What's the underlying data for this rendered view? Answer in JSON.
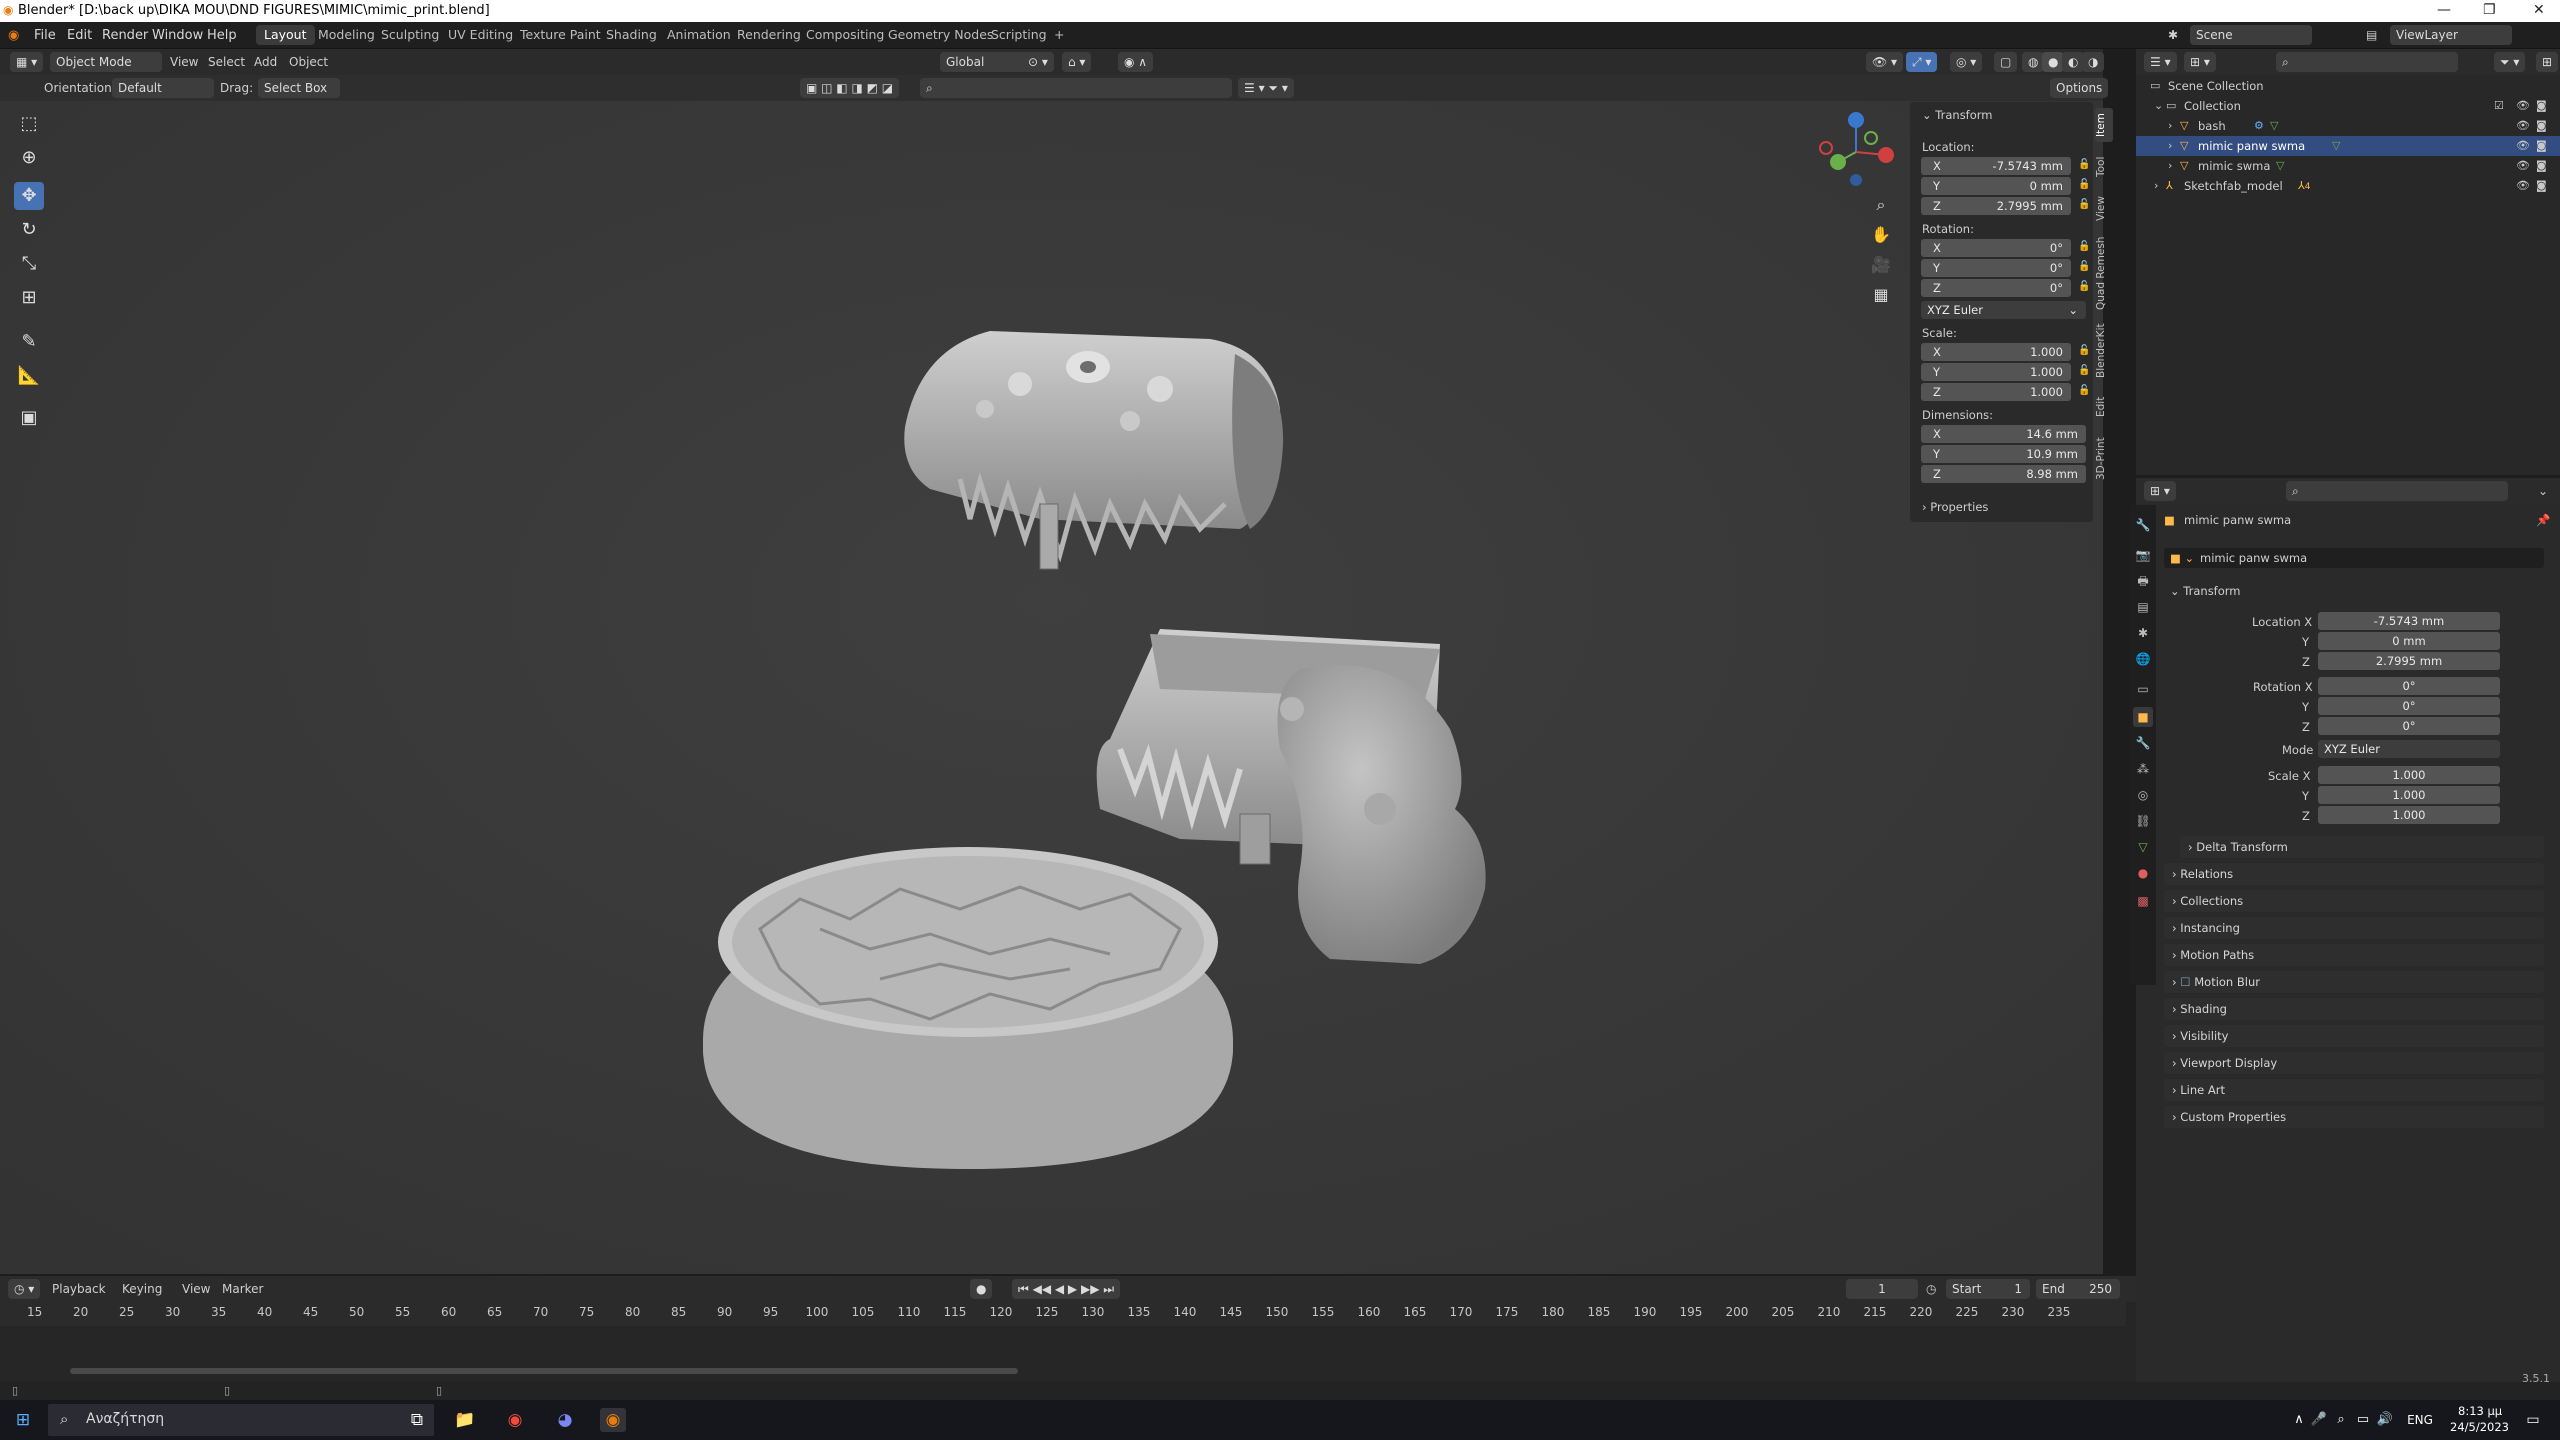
{
  "titlebar": {
    "title": "Blender* [D:\\back up\\DIKA MOU\\DND FIGURES\\MIMIC\\mimic_print.blend]",
    "min": "—",
    "max": "❐",
    "close": "✕"
  },
  "menu": {
    "file": "File",
    "edit": "Edit",
    "render": "Render",
    "window": "Window",
    "help": "Help"
  },
  "workspaces": [
    "Layout",
    "Modeling",
    "Sculpting",
    "UV Editing",
    "Texture Paint",
    "Shading",
    "Animation",
    "Rendering",
    "Compositing",
    "Geometry Nodes",
    "Scripting"
  ],
  "workspace_add": "+",
  "scene": {
    "label": "Scene",
    "viewlayer": "ViewLayer"
  },
  "viewport": {
    "mode": "Object Mode",
    "menus": [
      "View",
      "Select",
      "Add",
      "Object"
    ],
    "transform_orientation": "Global",
    "orientation_label": "Orientation:",
    "orientation_value": "Default",
    "drag_label": "Drag:",
    "drag_value": "Select Box",
    "options": "Options"
  },
  "npanel": {
    "section": "Transform",
    "location_label": "Location:",
    "location": [
      {
        "axis": "X",
        "value": "-7.5743 mm"
      },
      {
        "axis": "Y",
        "value": "0 mm"
      },
      {
        "axis": "Z",
        "value": "2.7995 mm"
      }
    ],
    "rotation_label": "Rotation:",
    "rotation": [
      {
        "axis": "X",
        "value": "0°"
      },
      {
        "axis": "Y",
        "value": "0°"
      },
      {
        "axis": "Z",
        "value": "0°"
      }
    ],
    "rotation_mode": "XYZ Euler",
    "scale_label": "Scale:",
    "scale": [
      {
        "axis": "X",
        "value": "1.000"
      },
      {
        "axis": "Y",
        "value": "1.000"
      },
      {
        "axis": "Z",
        "value": "1.000"
      }
    ],
    "dimensions_label": "Dimensions:",
    "dimensions": [
      {
        "axis": "X",
        "value": "14.6 mm"
      },
      {
        "axis": "Y",
        "value": "10.9 mm"
      },
      {
        "axis": "Z",
        "value": "8.98 mm"
      }
    ],
    "properties": "Properties",
    "tabs": [
      "Item",
      "Tool",
      "View",
      "Quad Remesh",
      "BlenderKit",
      "Edit",
      "3D-Print"
    ]
  },
  "outliner": {
    "rows": [
      {
        "label": "Scene Collection"
      },
      {
        "label": "Collection"
      },
      {
        "label": "bash"
      },
      {
        "label": "mimic panw swma"
      },
      {
        "label": "mimic swma"
      },
      {
        "label": "Sketchfab_model"
      }
    ],
    "sketchfab_count": "4"
  },
  "properties": {
    "object_name": "mimic panw swma",
    "object_name_field": "mimic panw swma",
    "transform": "Transform",
    "location_x_label": "Location X",
    "location": [
      "-7.5743 mm",
      "0 mm",
      "2.7995 mm"
    ],
    "rotation_x_label": "Rotation X",
    "rotation": [
      "0°",
      "0°",
      "0°"
    ],
    "mode_label": "Mode",
    "mode": "XYZ Euler",
    "scale_x_label": "Scale X",
    "scale": [
      "1.000",
      "1.000",
      "1.000"
    ],
    "y": "Y",
    "z": "Z",
    "sections": [
      "Delta Transform",
      "Relations",
      "Collections",
      "Instancing",
      "Motion Paths",
      "Motion Blur",
      "Shading",
      "Visibility",
      "Viewport Display",
      "Line Art",
      "Custom Properties"
    ]
  },
  "timeline": {
    "menus": [
      "Playback",
      "Keying",
      "View",
      "Marker"
    ],
    "current_frame": "1",
    "start_label": "Start",
    "start": "1",
    "end_label": "End",
    "end": "250",
    "ticks": [
      "15",
      "20",
      "25",
      "30",
      "35",
      "40",
      "45",
      "50",
      "55",
      "60",
      "65",
      "70",
      "75",
      "80",
      "85",
      "90",
      "95",
      "100",
      "105",
      "110",
      "115",
      "120",
      "125",
      "130",
      "135",
      "140",
      "145",
      "150",
      "155",
      "160",
      "165",
      "170",
      "175",
      "180",
      "185",
      "190",
      "195",
      "200",
      "205",
      "210",
      "215",
      "220",
      "225",
      "230",
      "235"
    ]
  },
  "statusbar": {
    "version": "3.5.1"
  },
  "taskbar": {
    "search_placeholder": "Αναζήτηση",
    "lang": "ENG",
    "time": "8:13 μμ",
    "date": "24/5/2023"
  },
  "colors": {
    "accent": "#4772b3",
    "viewport_bg": "#3a3a3a",
    "active_object": "#ffb84a"
  }
}
